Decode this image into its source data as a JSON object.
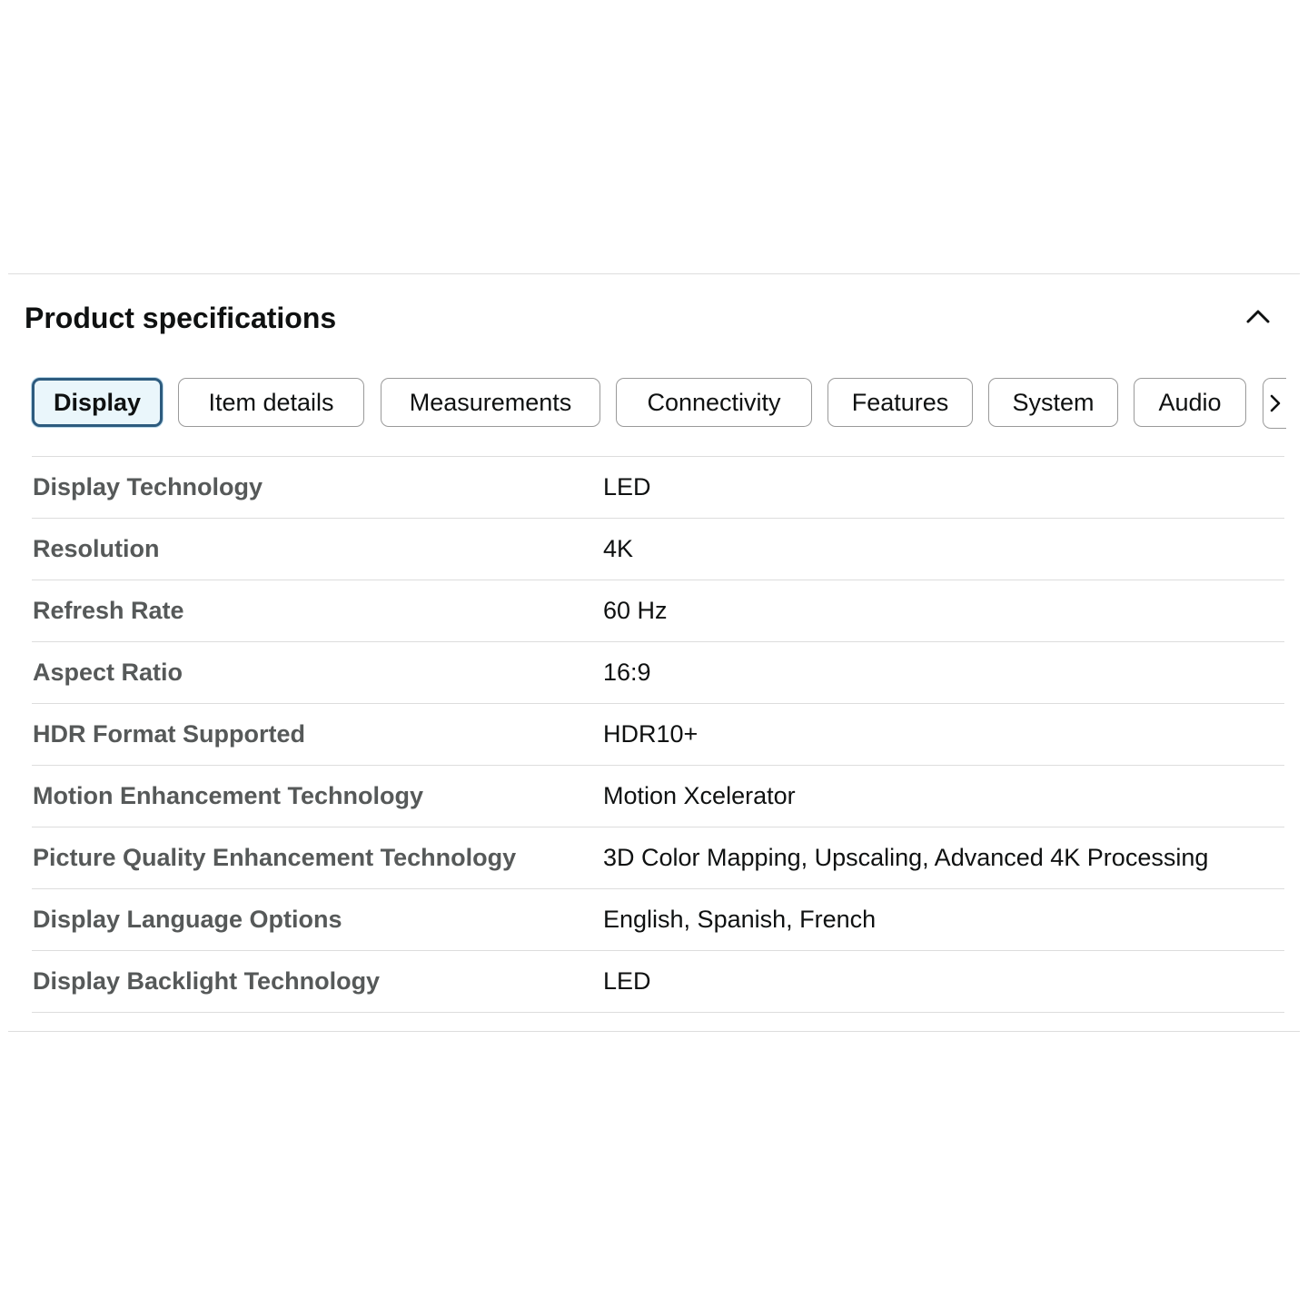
{
  "section": {
    "title": "Product specifications",
    "collapse_icon": "chevron-up-icon"
  },
  "tabs": [
    {
      "label": "Display",
      "active": true
    },
    {
      "label": "Item details",
      "active": false
    },
    {
      "label": "Measurements",
      "active": false
    },
    {
      "label": "Connectivity",
      "active": false
    },
    {
      "label": "Features",
      "active": false
    },
    {
      "label": "System",
      "active": false
    },
    {
      "label": "Audio",
      "active": false
    }
  ],
  "tabs_next_icon": "chevron-right-icon",
  "specs": [
    {
      "label": "Display Technology",
      "value": "LED"
    },
    {
      "label": "Resolution",
      "value": "4K"
    },
    {
      "label": "Refresh Rate",
      "value": "60 Hz"
    },
    {
      "label": "Aspect Ratio",
      "value": "16:9"
    },
    {
      "label": "HDR Format Supported",
      "value": "HDR10+"
    },
    {
      "label": "Motion Enhancement Technology",
      "value": "Motion Xcelerator"
    },
    {
      "label": "Picture Quality Enhancement Technology",
      "value": "3D Color Mapping, Upscaling, Advanced 4K Processing"
    },
    {
      "label": "Display Language Options",
      "value": "English, Spanish, French"
    },
    {
      "label": "Display Backlight Technology",
      "value": "LED"
    }
  ],
  "colors": {
    "active_tab_border": "#2d5b7e",
    "active_tab_background": "#eaf6fb",
    "label_text": "#565959",
    "value_text": "#0f1111",
    "divider": "#dddddd"
  }
}
